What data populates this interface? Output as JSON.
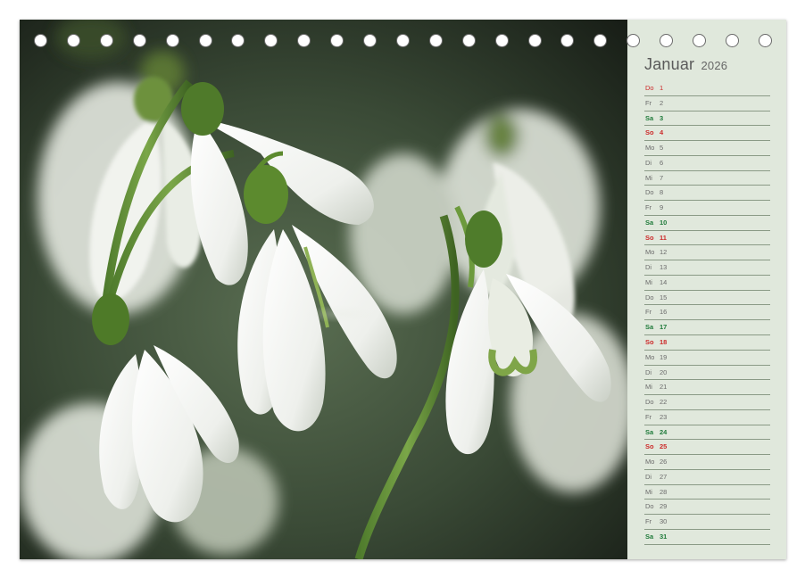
{
  "calendar": {
    "month": "Januar",
    "year": "2026",
    "days": [
      {
        "wd": "Do",
        "d": "1",
        "type": "hol"
      },
      {
        "wd": "Fr",
        "d": "2",
        "type": "week"
      },
      {
        "wd": "Sa",
        "d": "3",
        "type": "sat"
      },
      {
        "wd": "So",
        "d": "4",
        "type": "sun"
      },
      {
        "wd": "Mo",
        "d": "5",
        "type": "week"
      },
      {
        "wd": "Di",
        "d": "6",
        "type": "week"
      },
      {
        "wd": "Mi",
        "d": "7",
        "type": "week"
      },
      {
        "wd": "Do",
        "d": "8",
        "type": "week"
      },
      {
        "wd": "Fr",
        "d": "9",
        "type": "week"
      },
      {
        "wd": "Sa",
        "d": "10",
        "type": "sat"
      },
      {
        "wd": "So",
        "d": "11",
        "type": "sun"
      },
      {
        "wd": "Mo",
        "d": "12",
        "type": "week"
      },
      {
        "wd": "Di",
        "d": "13",
        "type": "week"
      },
      {
        "wd": "Mi",
        "d": "14",
        "type": "week"
      },
      {
        "wd": "Do",
        "d": "15",
        "type": "week"
      },
      {
        "wd": "Fr",
        "d": "16",
        "type": "week"
      },
      {
        "wd": "Sa",
        "d": "17",
        "type": "sat"
      },
      {
        "wd": "So",
        "d": "18",
        "type": "sun"
      },
      {
        "wd": "Mo",
        "d": "19",
        "type": "week"
      },
      {
        "wd": "Di",
        "d": "20",
        "type": "week"
      },
      {
        "wd": "Mi",
        "d": "21",
        "type": "week"
      },
      {
        "wd": "Do",
        "d": "22",
        "type": "week"
      },
      {
        "wd": "Fr",
        "d": "23",
        "type": "week"
      },
      {
        "wd": "Sa",
        "d": "24",
        "type": "sat"
      },
      {
        "wd": "So",
        "d": "25",
        "type": "sun"
      },
      {
        "wd": "Mo",
        "d": "26",
        "type": "week"
      },
      {
        "wd": "Di",
        "d": "27",
        "type": "week"
      },
      {
        "wd": "Mi",
        "d": "28",
        "type": "week"
      },
      {
        "wd": "Do",
        "d": "29",
        "type": "week"
      },
      {
        "wd": "Fr",
        "d": "30",
        "type": "week"
      },
      {
        "wd": "Sa",
        "d": "31",
        "type": "sat"
      }
    ]
  },
  "binding": {
    "hole_count": 23
  },
  "colors": {
    "sidebar_bg": "#e0e8dc",
    "saturday": "#1f7a3a",
    "sunday": "#cc2a2a",
    "weekday": "#6b6b6b"
  },
  "photo": {
    "subject_icon": "snowdrop-flowers-photo"
  }
}
